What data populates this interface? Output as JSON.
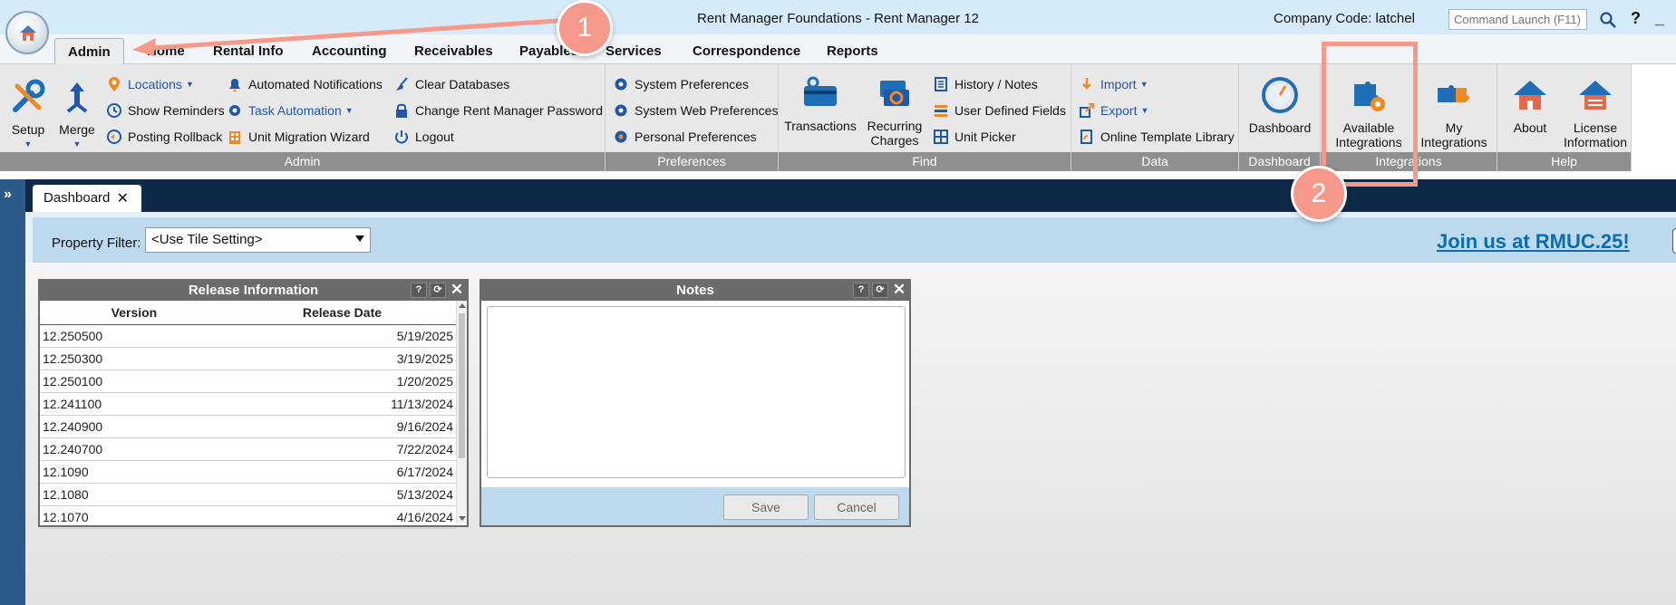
{
  "titlebar": {
    "title": "Rent Manager Foundations - Rent Manager 12",
    "company_code": "Company Code: latchel",
    "command_placeholder": "Command Launch (F11)",
    "help": "?",
    "minimize": "_"
  },
  "tabs": [
    {
      "label": "Admin",
      "active": true
    },
    {
      "label": "Home"
    },
    {
      "label": "Rental Info"
    },
    {
      "label": "Accounting"
    },
    {
      "label": "Receivables"
    },
    {
      "label": "Payables"
    },
    {
      "label": "Services"
    },
    {
      "label": "Correspondence"
    },
    {
      "label": "Reports"
    }
  ],
  "ribbon": {
    "admin": {
      "label": "Admin",
      "setup": "Setup",
      "merge": "Merge",
      "locations": "Locations",
      "show_reminders": "Show Reminders",
      "posting_rollback": "Posting Rollback",
      "automated_notifications": "Automated Notifications",
      "task_automation": "Task Automation",
      "unit_migration_wizard": "Unit Migration Wizard",
      "clear_databases": "Clear Databases",
      "change_password": "Change Rent Manager Password",
      "logout": "Logout"
    },
    "preferences": {
      "label": "Preferences",
      "system_preferences": "System Preferences",
      "system_web_preferences": "System Web Preferences",
      "personal_preferences": "Personal Preferences"
    },
    "find": {
      "label": "Find",
      "transactions": "Transactions",
      "recurring_1": "Recurring",
      "recurring_2": "Charges",
      "history_notes": "History / Notes",
      "user_defined_fields": "User Defined Fields",
      "unit_picker": "Unit Picker"
    },
    "data": {
      "label": "Data",
      "import": "Import",
      "export": "Export",
      "online_template_library": "Online Template Library"
    },
    "dashboard": {
      "label": "Dashboard",
      "dashboard": "Dashboard"
    },
    "integrations": {
      "label": "Integrations",
      "available_1": "Available",
      "available_2": "Integrations",
      "my_1": "My",
      "my_2": "Integrations"
    },
    "help": {
      "label": "Help",
      "about": "About",
      "license_1": "License",
      "license_2": "Information"
    }
  },
  "document_tab": {
    "label": "Dashboard"
  },
  "filter": {
    "label": "Property Filter:",
    "value": "<Use Tile Setting>",
    "banner_link": "Join us at RMUC.25!"
  },
  "release_info": {
    "title": "Release Information",
    "columns": [
      "Version",
      "Release Date"
    ],
    "rows": [
      {
        "version": "12.250500",
        "date": "5/19/2025"
      },
      {
        "version": "12.250300",
        "date": "3/19/2025"
      },
      {
        "version": "12.250100",
        "date": "1/20/2025"
      },
      {
        "version": "12.241100",
        "date": "11/13/2024"
      },
      {
        "version": "12.240900",
        "date": "9/16/2024"
      },
      {
        "version": "12.240700",
        "date": "7/22/2024"
      },
      {
        "version": "12.1090",
        "date": "6/17/2024"
      },
      {
        "version": "12.1080",
        "date": "5/13/2024"
      },
      {
        "version": "12.1070",
        "date": "4/16/2024"
      }
    ]
  },
  "notes": {
    "title": "Notes",
    "save": "Save",
    "cancel": "Cancel"
  },
  "widget_buttons": {
    "help": "?",
    "refresh": "⟳",
    "close": "✕"
  },
  "annotations": {
    "step1": "1",
    "step2": "2",
    "accent": "#f59a8a"
  }
}
